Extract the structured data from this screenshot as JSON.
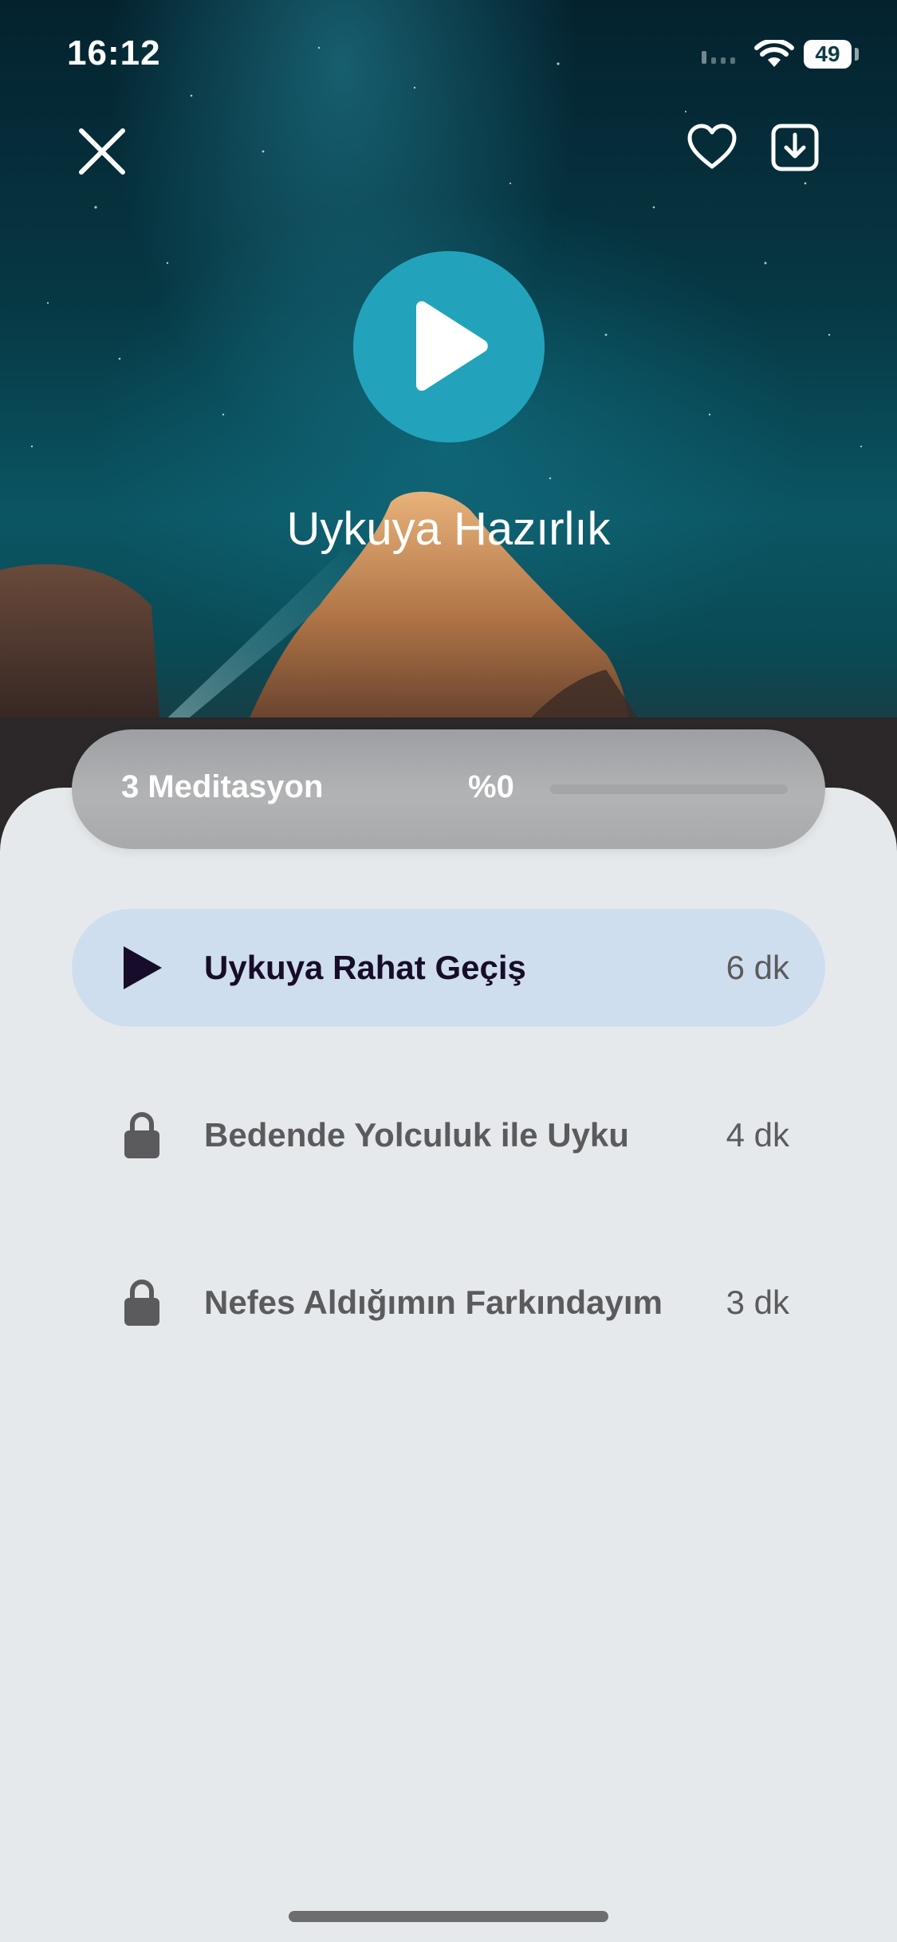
{
  "status_bar": {
    "time": "16:12",
    "battery": "49"
  },
  "header": {
    "close_icon": "close-icon",
    "favorite_icon": "heart-icon",
    "download_icon": "download-icon"
  },
  "player": {
    "title": "Uykuya Hazırlık",
    "play_icon": "play-icon"
  },
  "progress": {
    "count_label": "3 Meditasyon",
    "percent_label": "%0",
    "percent_value": 0
  },
  "tracks": [
    {
      "title": "Uykuya Rahat Geçiş",
      "duration": "6 dk",
      "state": "playable",
      "icon": "play-icon"
    },
    {
      "title": "Bedende Yolculuk ile Uyku",
      "duration": "4 dk",
      "state": "locked",
      "icon": "lock-icon"
    },
    {
      "title": "Nefes Aldığımın Farkındayım",
      "duration": "3 dk",
      "state": "locked",
      "icon": "lock-icon"
    }
  ],
  "colors": {
    "accent": "#22a3bb",
    "active_row": "#cfdeee",
    "sheet": "#e6e9ec",
    "active_text": "#170d2a",
    "muted_text": "#5b5b5e"
  }
}
